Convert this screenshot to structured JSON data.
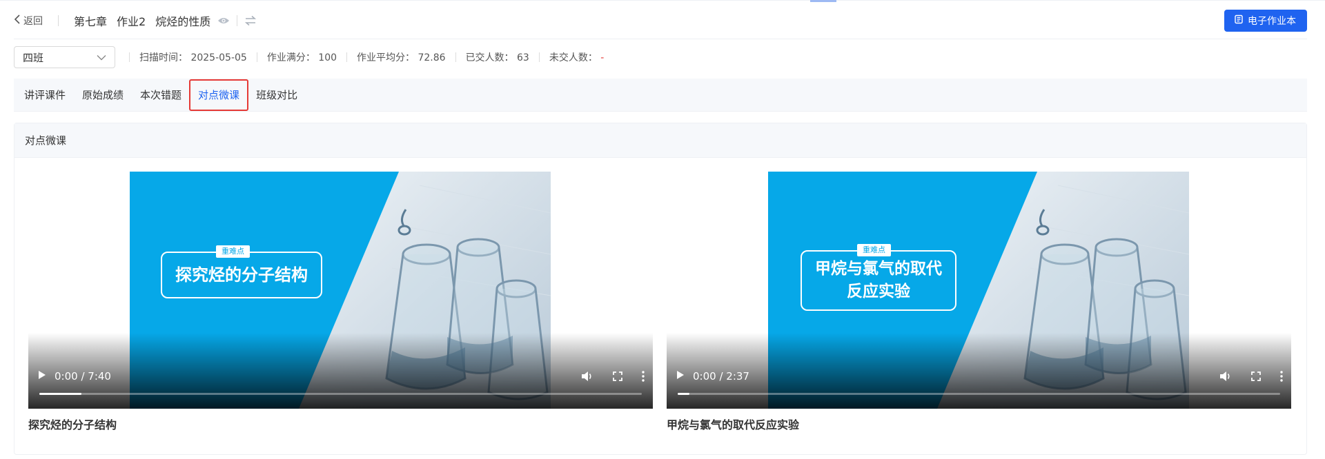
{
  "header": {
    "back_label": "返回",
    "chapter": "第七章",
    "assignment": "作业2",
    "topic": "烷烃的性质",
    "ebook_button": "电子作业本"
  },
  "info": {
    "class_select": "四班",
    "scan_time_label": "扫描时间：",
    "scan_time": "2025-05-05",
    "full_score_label": "作业满分：",
    "full_score": "100",
    "avg_score_label": "作业平均分：",
    "avg_score": "72.86",
    "submitted_label": "已交人数：",
    "submitted": "63",
    "not_submitted_label": "未交人数：",
    "not_submitted": "-"
  },
  "tabs": [
    {
      "label": "讲评课件"
    },
    {
      "label": "原始成绩"
    },
    {
      "label": "本次错题"
    },
    {
      "label": "对点微课"
    },
    {
      "label": "班级对比"
    }
  ],
  "panel": {
    "title": "对点微课"
  },
  "videos": [
    {
      "tag": "重难点",
      "headline_line1": "探究烃的分子结构",
      "headline_line2": "",
      "time": "0:00 / 7:40",
      "progress": 0.07,
      "title": "探究烃的分子结构"
    },
    {
      "tag": "重难点",
      "headline_line1": "甲烷与氯气的取代",
      "headline_line2": "反应实验",
      "time": "0:00 / 2:37",
      "progress": 0.02,
      "title": "甲烷与氯气的取代反应实验"
    }
  ],
  "colors": {
    "accent": "#1f63f0",
    "highlight_border": "#e53935",
    "video_bg": "#06a8e8"
  }
}
